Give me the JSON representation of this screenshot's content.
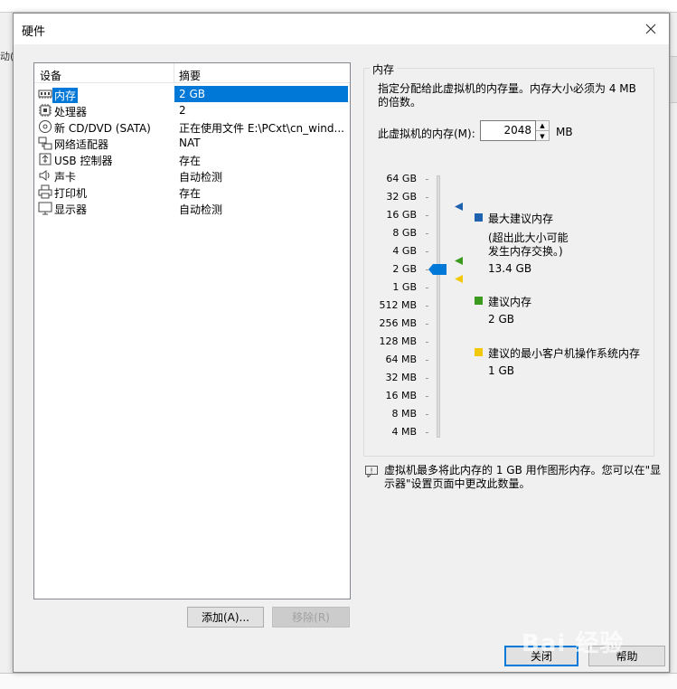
{
  "background": {
    "left_text": "动(H"
  },
  "dialog": {
    "title": "硬件",
    "devices": {
      "header": {
        "device": "设备",
        "summary": "摘要"
      },
      "rows": [
        {
          "name": "内存",
          "summary": "2 GB",
          "icon": "memory-icon"
        },
        {
          "name": "处理器",
          "summary": "2",
          "icon": "cpu-icon"
        },
        {
          "name": "新 CD/DVD (SATA)",
          "summary": "正在使用文件 E:\\PCxt\\cn_wind...",
          "icon": "cd-icon"
        },
        {
          "name": "网络适配器",
          "summary": "NAT",
          "icon": "network-icon"
        },
        {
          "name": "USB 控制器",
          "summary": "存在",
          "icon": "usb-icon"
        },
        {
          "name": "声卡",
          "summary": "自动检测",
          "icon": "speaker-icon"
        },
        {
          "name": "打印机",
          "summary": "存在",
          "icon": "printer-icon"
        },
        {
          "name": "显示器",
          "summary": "自动检测",
          "icon": "monitor-icon"
        }
      ]
    },
    "add_button": "添加(A)...",
    "remove_button": "移除(R)",
    "memory": {
      "group_title": "内存",
      "description": "指定分配给此虚拟机的内存量。内存大小必须为 4 MB 的倍数。",
      "label": "此虚拟机的内存(M):",
      "value": "2048",
      "unit": "MB",
      "scale": [
        "64 GB",
        "32 GB",
        "16 GB",
        "8 GB",
        "4 GB",
        "2 GB",
        "1 GB",
        "512 MB",
        "256 MB",
        "128 MB",
        "64 MB",
        "32 MB",
        "16 MB",
        "8 MB",
        "4 MB"
      ],
      "legend": {
        "max": {
          "title": "最大建议内存",
          "note1": "(超出此大小可能",
          "note2": "发生内存交换。)",
          "value": "13.4 GB",
          "color": "#1e62b0"
        },
        "recommended": {
          "title": "建议内存",
          "value": "2 GB",
          "color": "#3c9a1e"
        },
        "guest_min": {
          "title": "建议的最小客户机操作系统内存",
          "value": "1 GB",
          "color": "#f2c80a"
        }
      }
    },
    "info_text": "虚拟机最多将此内存的 1 GB 用作图形内存。您可以在\"显示器\"设置页面中更改此数量。",
    "close_button": "关闭",
    "help_button": "帮助",
    "watermark": "Bai 经验"
  }
}
